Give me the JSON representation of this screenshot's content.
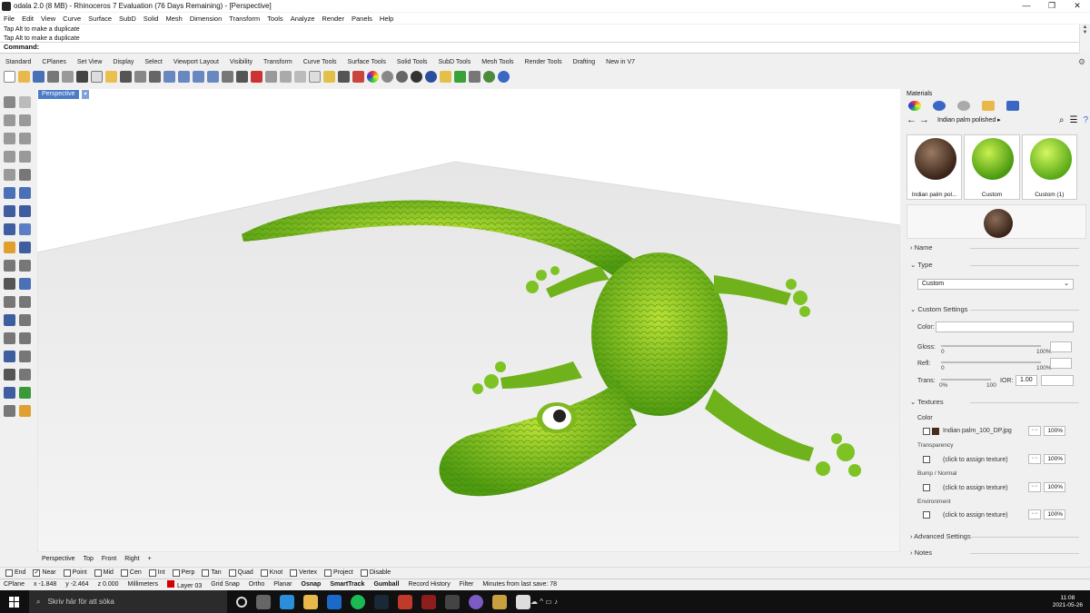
{
  "window": {
    "title": "odala 2.0 (8 MB) - Rhinoceros 7 Evaluation (76 Days Remaining) - [Perspective]",
    "minimize": "—",
    "maximize": "❐",
    "close": "✕"
  },
  "menu": [
    "File",
    "Edit",
    "View",
    "Curve",
    "Surface",
    "SubD",
    "Solid",
    "Mesh",
    "Dimension",
    "Transform",
    "Tools",
    "Analyze",
    "Render",
    "Panels",
    "Help"
  ],
  "command": {
    "history": [
      "Tap Alt to make a duplicate",
      "Tap Alt to make a duplicate"
    ],
    "prompt": "Command:"
  },
  "toolbar_tabs": [
    "Standard",
    "CPlanes",
    "Set View",
    "Display",
    "Select",
    "Viewport Layout",
    "Visibility",
    "Transform",
    "Curve Tools",
    "Surface Tools",
    "Solid Tools",
    "SubD Tools",
    "Mesh Tools",
    "Render Tools",
    "Drafting",
    "New in V7"
  ],
  "viewport": {
    "name": "Perspective",
    "tabs": [
      "Perspective",
      "Top",
      "Front",
      "Right",
      "+"
    ]
  },
  "materials_panel": {
    "title": "Materials",
    "breadcrumb": "Indian palm polished ▸",
    "thumbnails": [
      {
        "label": "Indian palm pol...",
        "color": "#5a3a28"
      },
      {
        "label": "Custom",
        "color": "#7ac41a"
      },
      {
        "label": "Custom (1)",
        "color": "#8fd22a"
      }
    ],
    "sections": {
      "name": "Name",
      "type": "Type",
      "type_value": "Custom",
      "custom_settings": "Custom Settings",
      "color_label": "Color:",
      "gloss_label": "Gloss:",
      "refl_label": "Refl:",
      "trans_label": "Trans:",
      "ior_label": "IOR:",
      "ior_value": "1.00",
      "slider_min": "0",
      "slider_max": "100%",
      "trans_min": "0%",
      "trans_max": "100",
      "textures": "Textures",
      "tex_color": "Color",
      "tex_color_file": "Indian palm_100_DP.jpg",
      "tex_transparency": "Transparency",
      "tex_bump": "Bump / Normal",
      "tex_env": "Environment",
      "assign": "(click to assign texture)",
      "pct": "100%",
      "advanced": "Advanced Settings",
      "notes": "Notes"
    }
  },
  "osnap": [
    {
      "label": "End",
      "checked": false
    },
    {
      "label": "Near",
      "checked": true
    },
    {
      "label": "Point",
      "checked": false
    },
    {
      "label": "Mid",
      "checked": false
    },
    {
      "label": "Cen",
      "checked": false
    },
    {
      "label": "Int",
      "checked": false
    },
    {
      "label": "Perp",
      "checked": false
    },
    {
      "label": "Tan",
      "checked": false
    },
    {
      "label": "Quad",
      "checked": false
    },
    {
      "label": "Knot",
      "checked": false
    },
    {
      "label": "Vertex",
      "checked": false
    },
    {
      "label": "Project",
      "checked": false
    },
    {
      "label": "Disable",
      "checked": false
    }
  ],
  "status": {
    "cplane": "CPlane",
    "x": "x -1.848",
    "y": "y -2.464",
    "z": "z 0.000",
    "units": "Millimeters",
    "layer": "Layer 03",
    "grid_snap": "Grid Snap",
    "ortho": "Ortho",
    "planar": "Planar",
    "osnap": "Osnap",
    "smarttrack": "SmartTrack",
    "gumball": "Gumball",
    "record_history": "Record History",
    "filter": "Filter",
    "save_info": "Minutes from last save: 78"
  },
  "taskbar": {
    "search_placeholder": "Skriv här för att söka",
    "time": "11:08",
    "date": "2021-05-26"
  }
}
